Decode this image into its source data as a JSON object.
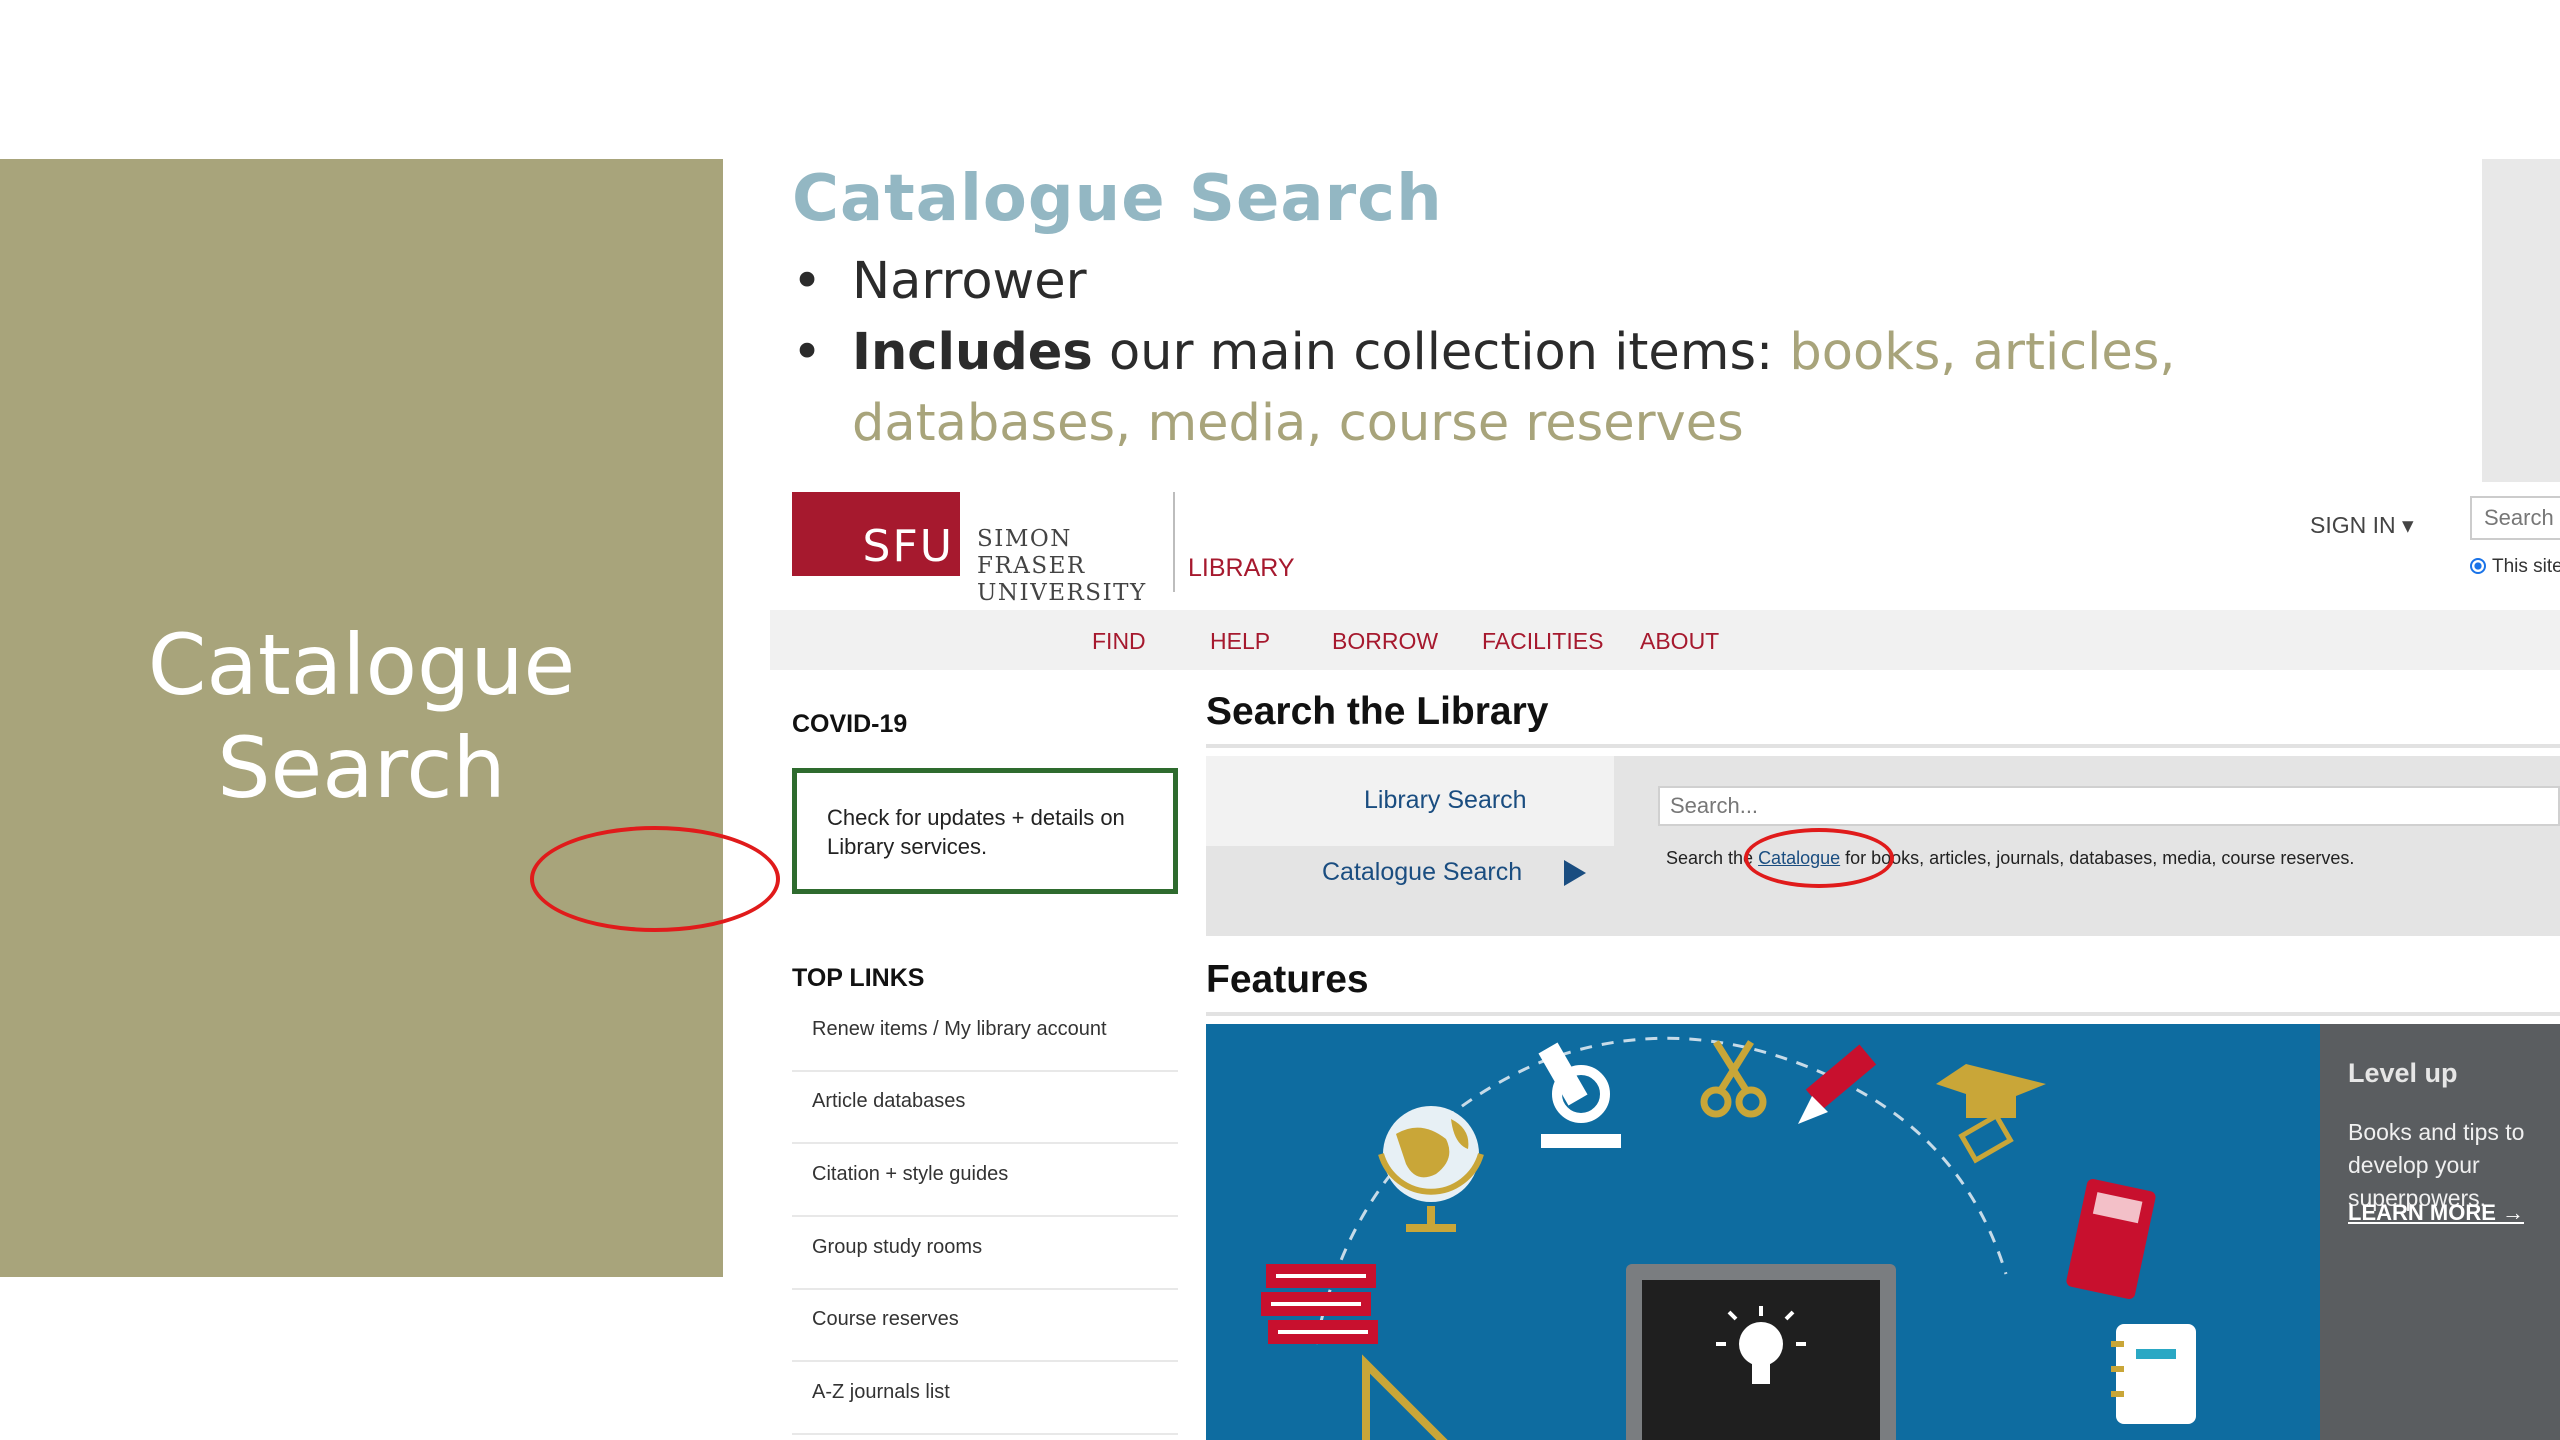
{
  "slide": {
    "panel_title": "Catalogue\nSearch",
    "heading": "Catalogue Search",
    "bullet1": "Narrower",
    "bullet2_bold": "Includes",
    "bullet2_text": " our main collection items: ",
    "bullet2_items": "books, articles, databases, media, course reserves"
  },
  "site": {
    "logo": "SFU",
    "university": "SIMON FRASER\nUNIVERSITY",
    "library": "LIBRARY",
    "sign_in": "SIGN IN ▾",
    "search_placeholder": "Search",
    "radio_label": "This site",
    "nav": [
      "FIND",
      "HELP",
      "BORROW",
      "FACILITIES",
      "ABOUT"
    ],
    "covid_title": "COVID-19",
    "covid_text": "Check for updates + details on Library services.",
    "top_links_title": "TOP LINKS",
    "top_links": [
      "Renew items / My library account",
      "Article databases",
      "Citation + style guides",
      "Group study rooms",
      "Course reserves",
      "A-Z journals list"
    ],
    "search_title": "Search the Library",
    "tab_library": "Library Search",
    "tab_catalogue": "Catalogue Search",
    "catalogue_placeholder": "Search...",
    "note_prefix": "Search the ",
    "note_link": "Catalogue",
    "note_suffix": " for books, articles, journals, databases, media, course reserves.",
    "features_title": "Features",
    "levelup_title": "Level up",
    "levelup_text": "Books and tips to develop your superpowers.",
    "levelup_link": "LEARN MORE →"
  },
  "colors": {
    "panel": "#a8a47b",
    "heading": "#93b7c3",
    "sfu_red": "#a6192e",
    "banner": "#0e6ca0",
    "annotation_red": "#e01b1b"
  }
}
